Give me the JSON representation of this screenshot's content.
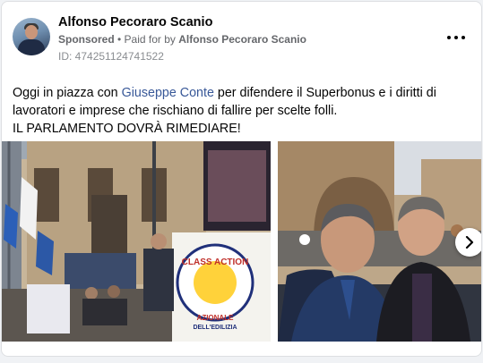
{
  "post": {
    "author": "Alfonso Pecoraro Scanio",
    "sponsored_label": "Sponsored",
    "separator": " • ",
    "paid_for_prefix": "Paid for by ",
    "paid_for_name": "Alfonso Pecoraro Scanio",
    "ad_id": "ID: 474251124741522",
    "text_before_link": "Oggi in piazza con ",
    "link_text": "Giuseppe Conte",
    "text_after_link": " per difendere il Superbonus e i diritti di lavoratori e imprese che rischiano di fallire per scelte folli.",
    "text_line3": "IL PARLAMENTO DOVRÀ RIMEDIARE!"
  },
  "images": {
    "banner_line1": "CLASS ACTION",
    "banner_line2": "AZIONALE",
    "banner_line3": "DELL'EDILIZIA"
  },
  "icons": {
    "more": "more-options-icon",
    "next": "chevron-right-icon"
  },
  "colors": {
    "link": "#385898",
    "secondary_text": "#65676b",
    "id_text": "#8a8d91"
  }
}
